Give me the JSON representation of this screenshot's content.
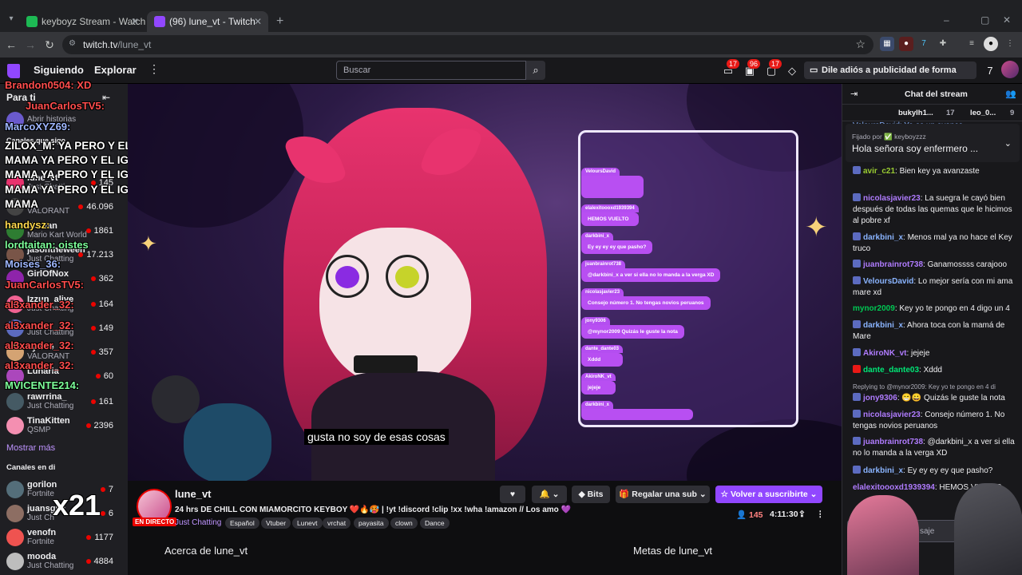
{
  "browser": {
    "tabs": [
      {
        "title": "keyboyz Stream - Watch Li",
        "active": false
      },
      {
        "title": "(96) lune_vt - Twitch",
        "active": true
      }
    ],
    "url_host": "twitch.tv",
    "url_path": "/lune_vt"
  },
  "topnav": {
    "following": "Siguiendo",
    "browse": "Explorar",
    "search_placeholder": "Buscar",
    "badges": [
      "17",
      "96",
      "17"
    ],
    "adfree": "Dile adiós a publicidad de forma gratuita"
  },
  "sidebar": {
    "for_you": "Para ti",
    "followed_title": "Canales que sigo",
    "followed": [
      {
        "name": "Abrir historias",
        "game": "",
        "viewers": ""
      },
      {
        "name": "lune_vt",
        "game": "Just Chatting",
        "viewers": "145"
      },
      {
        "name": "",
        "game": "VALORANT",
        "viewers": "46.096"
      },
      {
        "name": "Mictlan",
        "game": "Mario Kart World",
        "viewers": "1861"
      },
      {
        "name": "jasontheween",
        "game": "Just Chatting",
        "viewers": "17.213"
      },
      {
        "name": "GirlOfNox",
        "game": "",
        "viewers": "362"
      },
      {
        "name": "Izzun_alive",
        "game": "Just Chatting",
        "viewers": "164"
      },
      {
        "name": "",
        "game": "Just Chatting",
        "viewers": "149"
      },
      {
        "name": "sylvee",
        "game": "VALORANT",
        "viewers": "357"
      },
      {
        "name": "Lunaria",
        "game": "",
        "viewers": "60"
      },
      {
        "name": "rawrrina_",
        "game": "Just Chatting",
        "viewers": "161"
      },
      {
        "name": "TinaKitten",
        "game": "QSMP",
        "viewers": "2396"
      }
    ],
    "show_more": "Mostrar más",
    "recommended_title": "Canales en di",
    "recommended": [
      {
        "name": "gorilon",
        "game": "Fortnite",
        "viewers": "7"
      },
      {
        "name": "juansgua",
        "game": "Just Ch",
        "viewers": "6"
      },
      {
        "name": "venofn",
        "game": "Fortnite",
        "viewers": "1177"
      },
      {
        "name": "mooda",
        "game": "Just Chatting",
        "viewers": "4884"
      }
    ]
  },
  "overlay_chat": [
    {
      "text": "Brandon0504: XD",
      "color": "#ff4d4d"
    },
    {
      "text": "JuanCarlosTV5:",
      "color": "#ff4d4d"
    },
    {
      "text": "MarcoXYZ69:",
      "color": "#9fb7ff"
    },
    {
      "text": "ZILOX_M: YA PERO Y EL IG DE LA",
      "color": "#ffffff"
    },
    {
      "text": "MAMA  YA PERO Y EL IG DE LA",
      "color": "#ffffff"
    },
    {
      "text": "MAMA  YA PERO Y EL IG DE LA",
      "color": "#ffffff"
    },
    {
      "text": "MAMA  YA PERO Y EL IG DE LA",
      "color": "#ffffff"
    },
    {
      "text": "MAMA",
      "color": "#ffffff"
    },
    {
      "text": "handysz:",
      "color": "#ffd84d"
    },
    {
      "text": "lordtaitan: oistes",
      "color": "#7dff9a"
    },
    {
      "text": "Moises_36:",
      "color": "#9fb7ff"
    },
    {
      "text": "JuanCarlosTV5:",
      "color": "#ff4d4d"
    },
    {
      "text": "al3xander_32:",
      "color": "#ff4d4d"
    },
    {
      "text": "al3xander_32:",
      "color": "#ff4d4d"
    },
    {
      "text": "al3xander_32:",
      "color": "#ff4d4d"
    },
    {
      "text": "al3xander_32:",
      "color": "#ff4d4d"
    },
    {
      "text": "MVICENTE214:",
      "color": "#7dff9a"
    },
    {
      "text": "x21",
      "color": "#ffffff"
    }
  ],
  "video": {
    "subtitle": "gusta no soy de esas cosas",
    "onscreen_chat": [
      {
        "user": "VeloursDavid",
        "text": ""
      },
      {
        "user": "elalexitoooxd1939394",
        "text": "HEMOS VUELTO"
      },
      {
        "user": "darkbini_x",
        "text": "Ey ey ey ey que pasho?"
      },
      {
        "user": "juanbrainrot738",
        "text": "@darkbini_x a ver si ella no lo manda a la verga XD"
      },
      {
        "user": "nicolasjavier23",
        "text": "Consejo número 1. No tengas novios peruanos"
      },
      {
        "user": "jony9306",
        "text": "@mynor2009 Quizás le guste la nota"
      },
      {
        "user": "dante_dante03",
        "text": "Xddd"
      },
      {
        "user": "AkiroNK_vt",
        "text": "jejeje"
      },
      {
        "user": "darkbini_x",
        "text": ""
      }
    ]
  },
  "stream_info": {
    "name": "lune_vt",
    "live": "EN DIRECTO",
    "title": "24 hrs DE CHILL CON MIAMORCITO KEYBOY ❤️🔥🥵 | !yt !discord !clip !xx !wha !amazon // Los amo 💜",
    "category": "Just Chatting",
    "tags": [
      "Español",
      "Vtuber",
      "Lunevt",
      "vrchat",
      "payasita",
      "clown",
      "Dance"
    ],
    "bits": "Bits",
    "gift": "Regalar una sub",
    "subscribe": "Volver a suscribirte",
    "viewers": "145",
    "uptime": "4:11:30",
    "about": "Acerca de lune_vt",
    "goals": "Metas de lune_vt"
  },
  "chat": {
    "title": "Chat del stream",
    "leaderboard": [
      "bukylh1...",
      "17",
      "leo_0...",
      "9"
    ],
    "pinned_by": "Fijado por ✅ keyboyzzz",
    "pinned_text": "Hola señora soy enfermero ...",
    "partial_top": "VeloursDavid: Ya es un avance",
    "messages": [
      {
        "user": "avir_c21",
        "color": "#9acd32",
        "text": ": Bien key ya avanzaste"
      },
      {
        "user": "nicolasjavier23",
        "color": "#b07cff",
        "text": ": La suegra le cayó bien después de todas las quemas que le hicimos al pobre xf"
      },
      {
        "user": "darkbini_x",
        "color": "#8ab4ff",
        "text": ": Menos mal ya no hace el Key truco"
      },
      {
        "user": "juanbrainrot738",
        "color": "#b07cff",
        "text": ": Ganamossss carajooo"
      },
      {
        "user": "VeloursDavid",
        "color": "#8ab4ff",
        "text": ": Lo mejor sería con mi ama mare xd"
      },
      {
        "user": "mynor2009",
        "color": "#00c853",
        "text": ": Key yo te pongo en 4 digo un 4"
      },
      {
        "user": "darkbini_x",
        "color": "#8ab4ff",
        "text": ": Ahora toca con la mamá de Mare"
      },
      {
        "user": "AkiroNK_vt",
        "color": "#b07cff",
        "text": ": jejeje"
      },
      {
        "user": "dante_dante03",
        "color": "#00e676",
        "text": ": Xddd"
      },
      {
        "user": "jony9306",
        "color": "#b07cff",
        "text": ": 😁😀 Quizás le guste la nota"
      },
      {
        "user": "nicolasjavier23",
        "color": "#b07cff",
        "text": ": Consejo número 1. No tengas novios peruanos"
      },
      {
        "user": "juanbrainrot738",
        "color": "#b07cff",
        "text": ": @darkbini_x a ver si ella no lo manda a la verga XD"
      },
      {
        "user": "darkbini_x",
        "color": "#8ab4ff",
        "text": ": Ey ey ey ey que pasho?"
      },
      {
        "user": "elalexitoooxd1939394",
        "color": "#b07cff",
        "text": ": HEMOS VUELTO"
      }
    ],
    "reply_note": "Replying to @mynor2009: Key yo te pongo en 4 di",
    "input_placeholder": "saje"
  }
}
